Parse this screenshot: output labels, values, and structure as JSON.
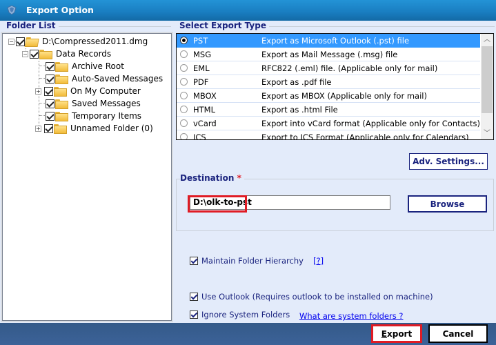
{
  "window": {
    "title": "Export Option",
    "icon": "app-shield-icon"
  },
  "folder_list": {
    "label": "Folder List",
    "tree": [
      {
        "label": "D:\\Compressed2011.dmg",
        "level": 0,
        "expander": "minus",
        "checked": true,
        "icon": "open-folder-icon"
      },
      {
        "label": "Data Records",
        "level": 1,
        "expander": "minus",
        "checked": true,
        "icon": "data-store-icon"
      },
      {
        "label": "Archive Root",
        "level": 2,
        "expander": null,
        "checked": true,
        "icon": "folder-icon"
      },
      {
        "label": "Auto-Saved Messages",
        "level": 2,
        "expander": null,
        "checked": true,
        "icon": "folder-icon"
      },
      {
        "label": "On My Computer",
        "level": 2,
        "expander": "plus",
        "checked": true,
        "icon": "folder-icon"
      },
      {
        "label": "Saved Messages",
        "level": 2,
        "expander": null,
        "checked": true,
        "icon": "folder-icon"
      },
      {
        "label": "Temporary Items",
        "level": 2,
        "expander": null,
        "checked": true,
        "icon": "folder-icon"
      },
      {
        "label": "Unnamed Folder (0)",
        "level": 2,
        "expander": "plus",
        "checked": true,
        "icon": "folder-icon"
      }
    ]
  },
  "export_type": {
    "label": "Select Export Type",
    "selected": "PST",
    "options": [
      {
        "name": "PST",
        "description": "Export as Microsoft Outlook (.pst) file"
      },
      {
        "name": "MSG",
        "description": "Export as Mail Message (.msg) file"
      },
      {
        "name": "EML",
        "description": "RFC822 (.eml) file. (Applicable only for mail)"
      },
      {
        "name": "PDF",
        "description": "Export as .pdf file"
      },
      {
        "name": "MBOX",
        "description": "Export as MBOX (Applicable only for mail)"
      },
      {
        "name": "HTML",
        "description": "Export as .html File"
      },
      {
        "name": "vCard",
        "description": "Export into vCard format (Applicable only for Contacts)"
      },
      {
        "name": "ICS",
        "description": "Export to ICS Format (Applicable only for Calendars)"
      }
    ]
  },
  "adv_settings_label": "Adv. Settings...",
  "destination": {
    "label": "Destination",
    "required_mark": "*",
    "value": "D:\\olk-to-pst",
    "browse_label": "Browse"
  },
  "options": {
    "maintain_hierarchy": {
      "label": "Maintain Folder Hierarchy",
      "checked": true,
      "help_link": "[?]"
    },
    "use_outlook": {
      "label": "Use Outlook (Requires outlook to be installed on machine)",
      "checked": true
    },
    "ignore_system": {
      "label": "Ignore System Folders",
      "checked": true,
      "help_link": "What are system folders ?"
    }
  },
  "footer": {
    "export_label_accel": "E",
    "export_label_rest": "xport",
    "cancel_label": "Cancel"
  },
  "colors": {
    "title_bar": "#1a7fc2",
    "selection": "#3399ff",
    "accent_text": "#1a237e",
    "highlight": "#e01b24",
    "footer_bar": "#385d8f"
  }
}
